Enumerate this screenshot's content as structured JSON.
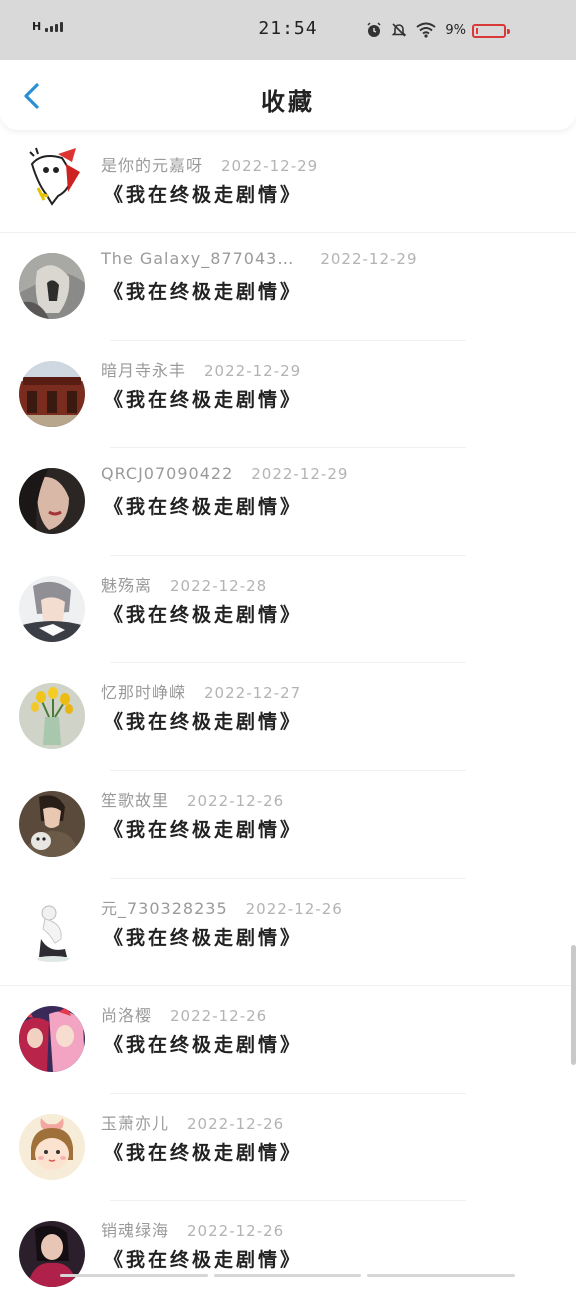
{
  "status_bar": {
    "network": "H",
    "time": "21:54",
    "battery_pct": "9%",
    "battery_level": 0.09,
    "battery_color": "#e03b3b",
    "icons": [
      "alarm-icon",
      "mute-icon",
      "wifi-icon",
      "battery-icon"
    ]
  },
  "header": {
    "back_icon": "chevron-left-icon",
    "title": "收藏",
    "accent": "#2b8fd6"
  },
  "items": [
    {
      "name": "是你的元嘉呀",
      "date": "2022-12-29",
      "book": "《我在终极走剧情》"
    },
    {
      "name": "The Galaxy_877043…",
      "date": "2022-12-29",
      "book": "《我在终极走剧情》"
    },
    {
      "name": "暗月寺永丰",
      "date": "2022-12-29",
      "book": "《我在终极走剧情》"
    },
    {
      "name": "QRCJ07090422",
      "date": "2022-12-29",
      "book": "《我在终极走剧情》"
    },
    {
      "name": "魅殇离",
      "date": "2022-12-28",
      "book": "《我在终极走剧情》"
    },
    {
      "name": "忆那时峥嵘",
      "date": "2022-12-27",
      "book": "《我在终极走剧情》"
    },
    {
      "name": "笙歌故里",
      "date": "2022-12-26",
      "book": "《我在终极走剧情》"
    },
    {
      "name": "元_730328235",
      "date": "2022-12-26",
      "book": "《我在终极走剧情》"
    },
    {
      "name": "尚洛樱",
      "date": "2022-12-26",
      "book": "《我在终极走剧情》"
    },
    {
      "name": "玉萧亦儿",
      "date": "2022-12-26",
      "book": "《我在终极走剧情》"
    },
    {
      "name": "销魂绿海",
      "date": "2022-12-26",
      "book": "《我在终极走剧情》"
    }
  ]
}
